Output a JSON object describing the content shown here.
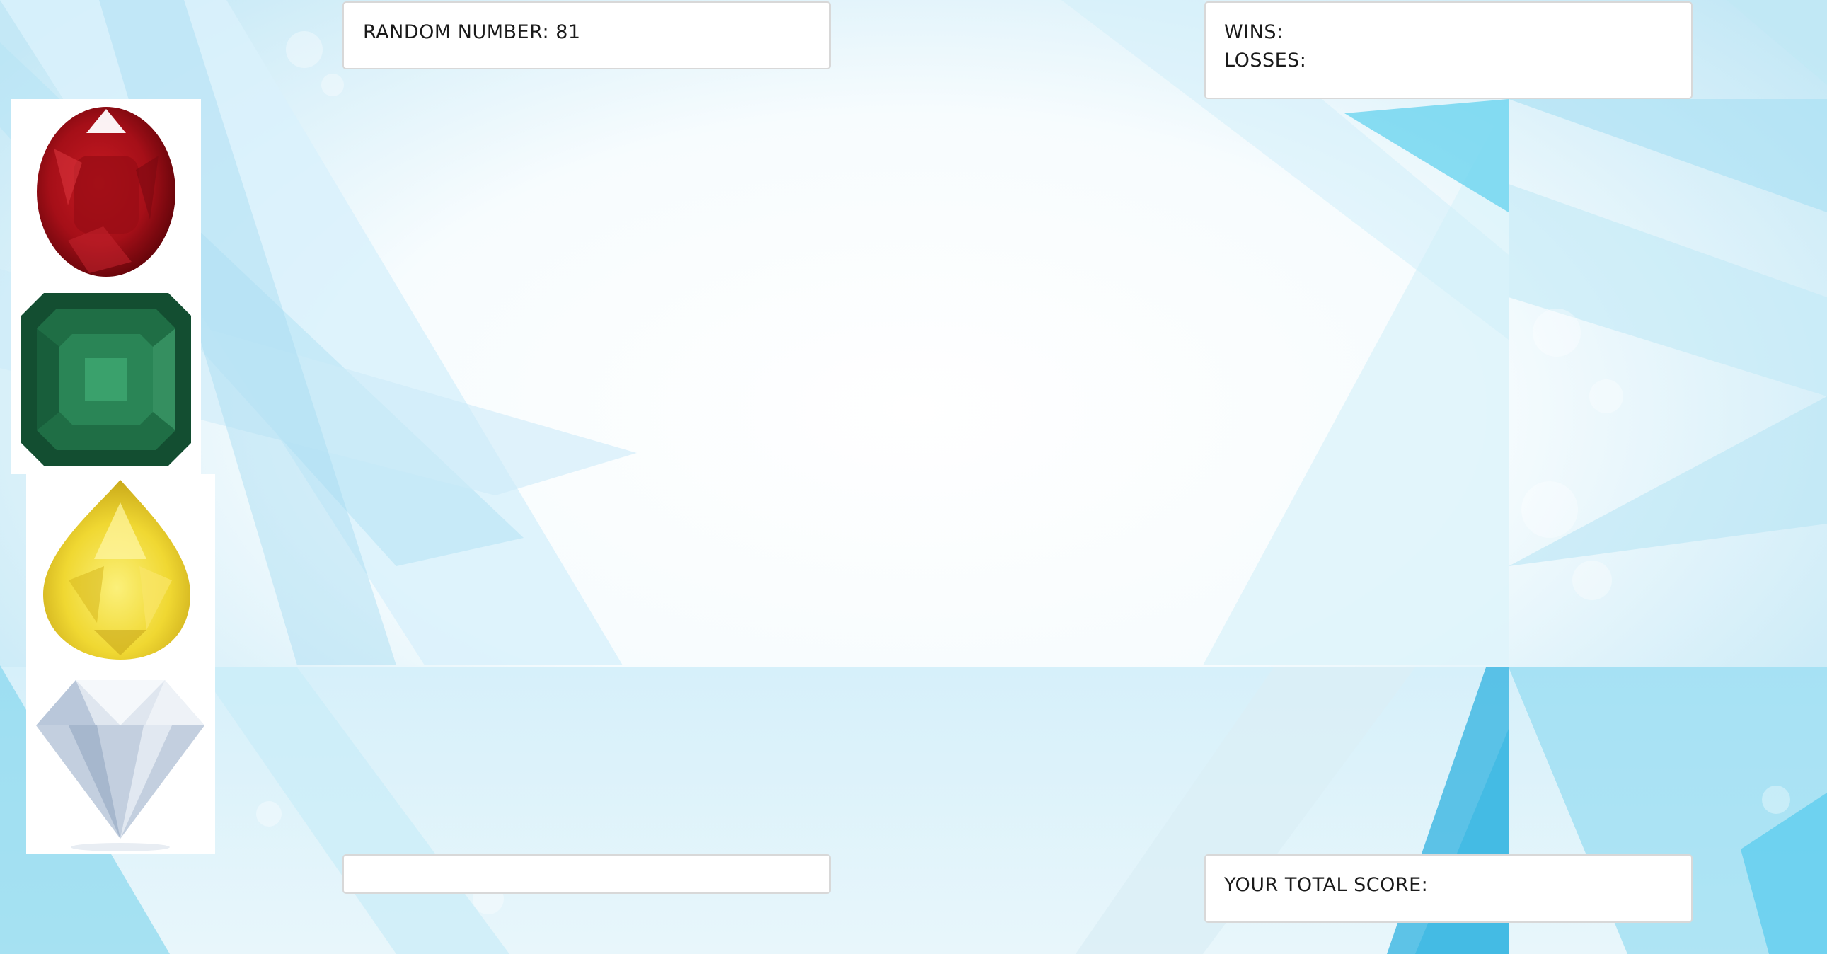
{
  "game": {
    "random_number_label": "RANDOM NUMBER:",
    "random_number_value": "81",
    "wins_label": "WINS:",
    "wins_value": "",
    "losses_label": "LOSSES:",
    "losses_value": "",
    "guess_value": "",
    "total_score_label": "YOUR TOTAL SCORE:",
    "total_score_value": ""
  },
  "crystals": [
    {
      "name": "ruby-crystal",
      "color": "#b3121c"
    },
    {
      "name": "emerald-crystal",
      "color": "#1f6e45"
    },
    {
      "name": "yellow-diamond-crystal",
      "color": "#f2dd3a"
    },
    {
      "name": "clear-diamond-crystal",
      "color": "#cfd9e6"
    }
  ],
  "colors": {
    "background_light": "#ffffff",
    "background_ice": "#bfe7f6",
    "background_cyan": "#49c9ea",
    "panel_border": "#d8d8d8",
    "text": "#1a1a1a"
  }
}
